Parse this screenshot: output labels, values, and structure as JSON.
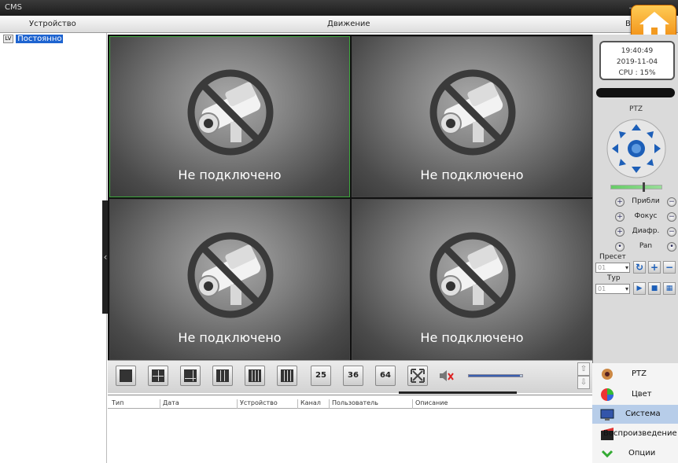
{
  "window": {
    "title": "CMS"
  },
  "menubar": {
    "device": "Устройство",
    "motion": "Движение",
    "right_partial": "В"
  },
  "tree": {
    "root_icon_text": "LV",
    "root_label": "Постоянно"
  },
  "tiles": [
    {
      "status": "Не подключено",
      "active": true
    },
    {
      "status": "Не подключено",
      "active": false
    },
    {
      "status": "Не подключено",
      "active": false
    },
    {
      "status": "Не подключено",
      "active": false
    }
  ],
  "toolbar": {
    "layouts": [
      "1",
      "4",
      "6",
      "9",
      "13",
      "16",
      "25",
      "36",
      "64"
    ],
    "volume_fraction": 0.95
  },
  "log": {
    "columns": [
      "Тип",
      "Дата",
      "Устройство",
      "Канал",
      "Пользователь",
      "Описание"
    ]
  },
  "status": {
    "time": "19:40:49",
    "date": "2019-11-04",
    "cpu": "CPU : 15%"
  },
  "ptz": {
    "title": "PTZ",
    "controls": [
      {
        "label": "Прибли",
        "left": "+",
        "right": "−"
      },
      {
        "label": "Фокус",
        "left": "+",
        "right": "−"
      },
      {
        "label": "Диафр.",
        "left": "+",
        "right": "−"
      },
      {
        "label": "Pan",
        "left": "•",
        "right": "•"
      }
    ],
    "preset": {
      "label": "Пресет",
      "value": "01"
    },
    "tour": {
      "label": "Тур",
      "value": "01"
    }
  },
  "side_menu": [
    {
      "label": "PTZ",
      "icon": "ptz-icon"
    },
    {
      "label": "Цвет",
      "icon": "color-icon"
    },
    {
      "label": "Система",
      "icon": "system-icon",
      "selected": true
    },
    {
      "label": "Воспроизведение",
      "icon": "playback-icon"
    },
    {
      "label": "Опции",
      "icon": "options-icon"
    }
  ],
  "colors": {
    "accent": "#1e64d0",
    "active_border": "#3ea83e",
    "home": "#f59a1a"
  }
}
